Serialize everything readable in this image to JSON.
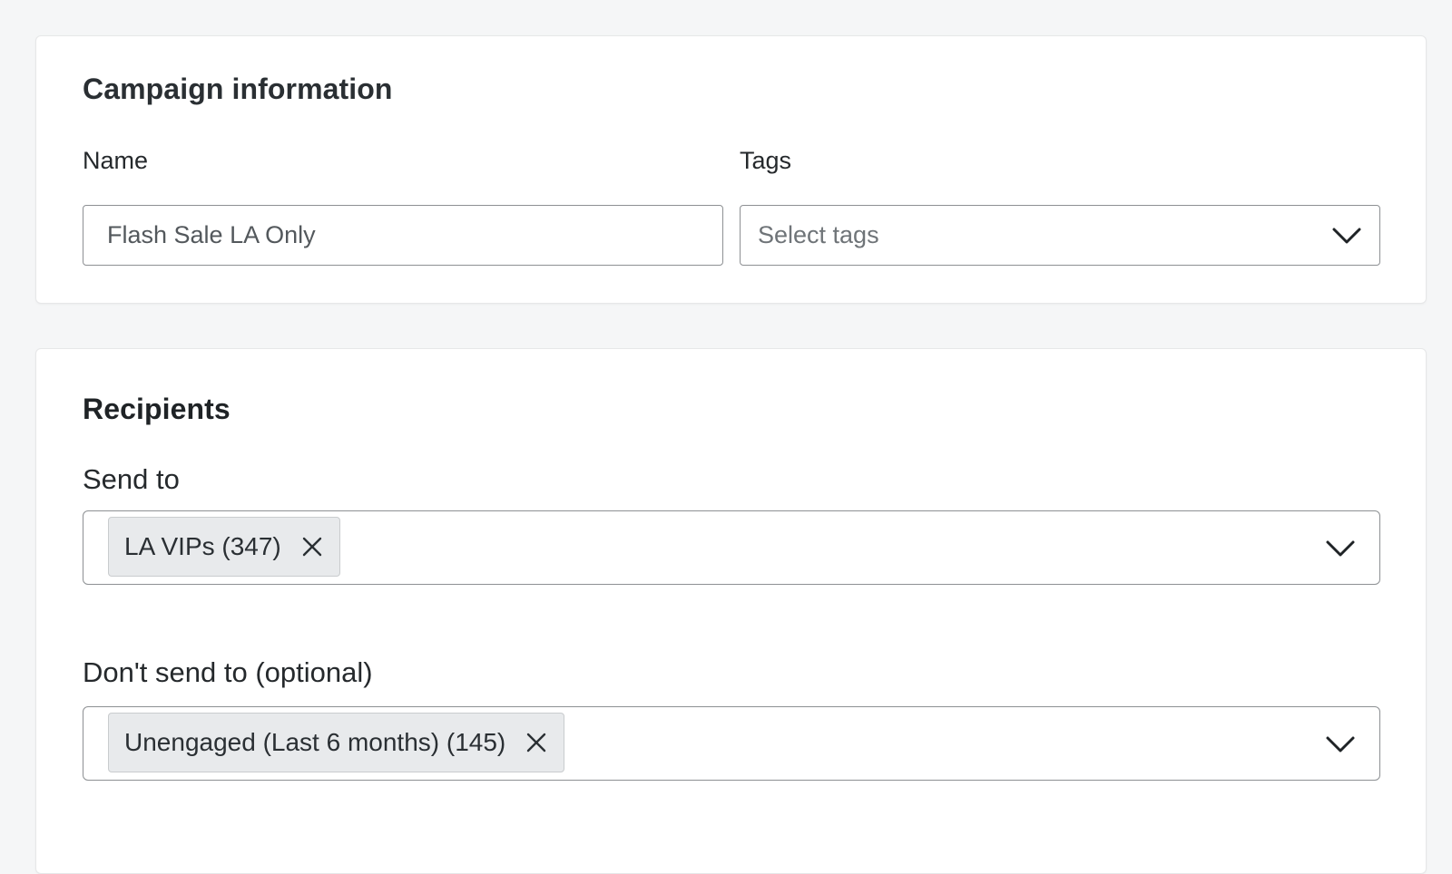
{
  "campaign_info": {
    "title": "Campaign information",
    "name_label": "Name",
    "name_value": "Flash Sale LA Only",
    "tags_label": "Tags",
    "tags_placeholder": "Select tags"
  },
  "recipients": {
    "title": "Recipients",
    "send_to_label": "Send to",
    "send_to_chips": [
      {
        "label": "LA VIPs (347)",
        "remove_icon": "close-icon"
      }
    ],
    "dont_send_label": "Don't send to (optional)",
    "dont_send_chips": [
      {
        "label": "Unengaged (Last 6 months) (145)",
        "remove_icon": "close-icon"
      }
    ]
  },
  "icons": {
    "dropdown": "chevron-down-icon",
    "remove": "close-icon"
  },
  "colors": {
    "page_background": "#f5f6f7",
    "card_background": "#ffffff",
    "input_border": "#8d9093",
    "chip_background": "#e8eaec",
    "text_primary": "#1f2326",
    "placeholder_text": "#6f7478"
  }
}
